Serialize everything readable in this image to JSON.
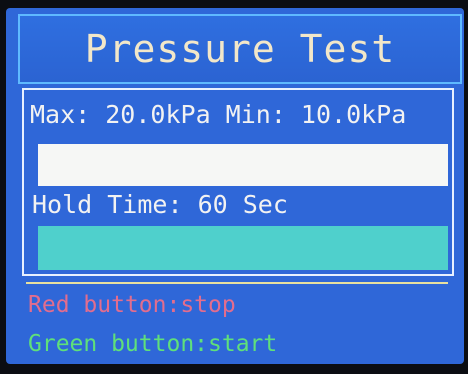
{
  "header": {
    "title": "Pressure Test"
  },
  "pressure": {
    "range_text": "Max: 20.0kPa Min: 10.0kPa"
  },
  "hold": {
    "time_text": "Hold Time: 60 Sec",
    "progress_fraction": 1.0
  },
  "instructions": {
    "red": "Red button:stop",
    "green": "Green button:start"
  },
  "colors": {
    "screen_bg": "#2f67d8",
    "title_text": "#f2e7c9",
    "progress_fill": "#4fd0cc",
    "red_text": "#e26d8e",
    "green_text": "#5fe07a"
  }
}
